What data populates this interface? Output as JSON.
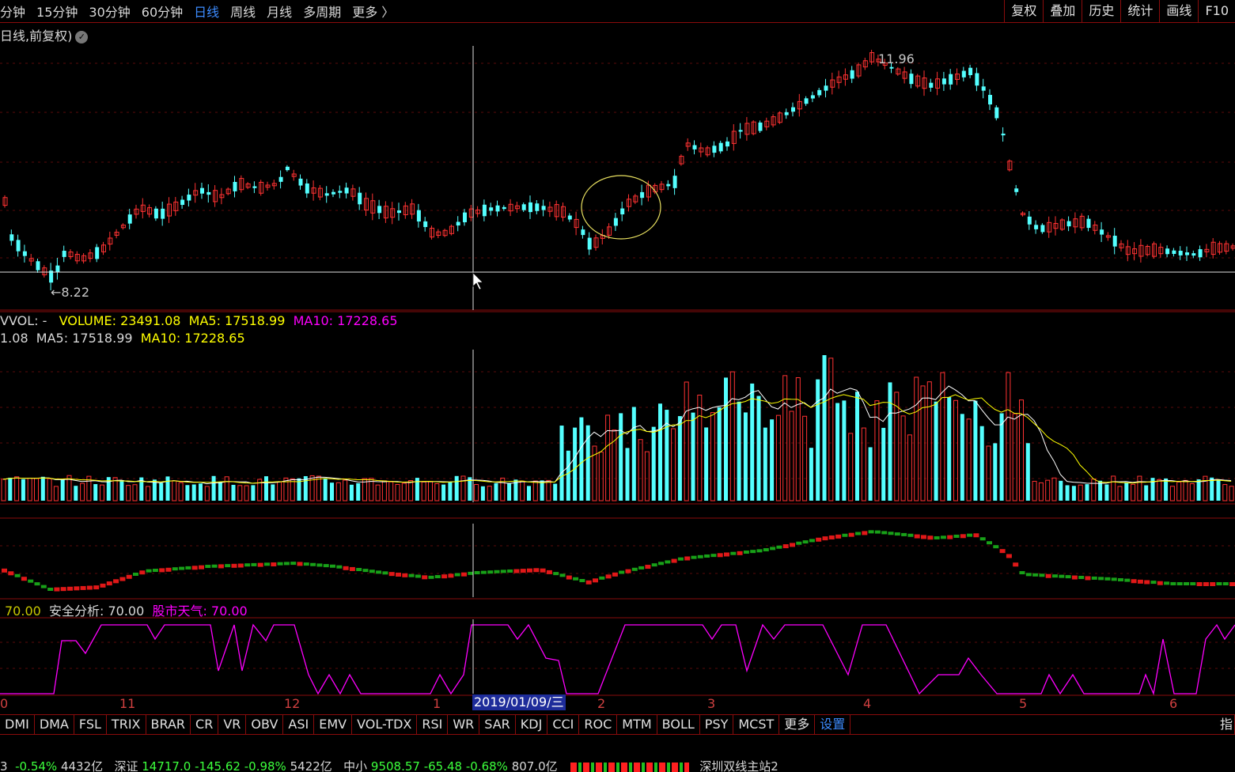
{
  "periods": [
    "分钟",
    "15分钟",
    "30分钟",
    "60分钟",
    "日线",
    "周线",
    "月线",
    "多周期",
    "更多 〉"
  ],
  "active_period": "日线",
  "right_tools": [
    "复权",
    "叠加",
    "历史",
    "统计",
    "画线",
    "F10"
  ],
  "chart_label": "日线,前复权)",
  "chart_label_icon": "check-circle-icon",
  "colors": {
    "up": "#ff3232",
    "down": "#54ffff",
    "ma5": "#ffffff",
    "ma10": "#ffff00",
    "magenta": "#ff00ff",
    "border": "#8a0c0c"
  },
  "price_labels": {
    "high": "11.96",
    "low": "←8.22"
  },
  "vol_legend": {
    "line1_prefix": "VVOL: -",
    "line1_volume": "VOLUME: 23491.08",
    "line1_ma5": "MA5: 17518.99",
    "line1_ma10": "MA10: 17228.65",
    "line2_prefix": "1.08",
    "line2_ma5": "MA5: 17518.99",
    "line2_ma10": "MA10: 17228.65"
  },
  "weather_legend": {
    "value": "70.00",
    "safety": "安全分析: 70.00",
    "weather": "股市天气: 70.00"
  },
  "x_labels": [
    "0",
    "11",
    "12",
    "1",
    "2",
    "3",
    "4",
    "5",
    "6"
  ],
  "cursor_date": "2019/01/09/三",
  "indicators": [
    "DMI",
    "DMA",
    "FSL",
    "TRIX",
    "BRAR",
    "CR",
    "VR",
    "OBV",
    "ASI",
    "EMV",
    "VOL-TDX",
    "RSI",
    "WR",
    "SAR",
    "KDJ",
    "CCI",
    "ROC",
    "MTM",
    "BOLL",
    "PSY",
    "MCST",
    "更多",
    "设置"
  ],
  "indicator_right": "指",
  "status_bar": {
    "seg1_a": "3",
    "seg1_b": "-0.54%",
    "seg1_c": "4432亿",
    "seg2_name": "深证",
    "seg2_val": "14717.0",
    "seg2_chg": "-145.62",
    "seg2_pct": "-0.98%",
    "seg2_amt": "5422亿",
    "seg3_name": "中小",
    "seg3_val": "9508.57",
    "seg3_chg": "-65.48",
    "seg3_pct": "-0.68%",
    "seg3_amt": "807.0亿",
    "seg4": "深圳双线主站2"
  }
}
